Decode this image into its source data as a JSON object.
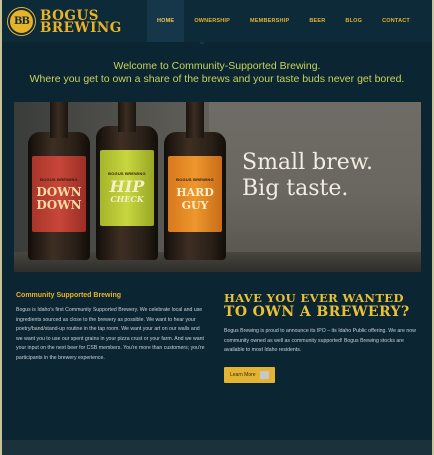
{
  "brand": {
    "badge": "BB",
    "line1": "BOGUS",
    "line2": "BREWING"
  },
  "nav": {
    "items": [
      {
        "label": "HOME",
        "active": true
      },
      {
        "label": "OWNERSHIP",
        "active": false
      },
      {
        "label": "MEMBERSHIP",
        "active": false
      },
      {
        "label": "BEER",
        "active": false
      },
      {
        "label": "BLOG",
        "active": false
      },
      {
        "label": "CONTACT",
        "active": false
      }
    ]
  },
  "welcome": {
    "line1": "Welcome to Community-Supported Brewing.",
    "line2": "Where you get to own a share of the brews and your taste buds never get bored."
  },
  "hero": {
    "headline_line1": "Small brew.",
    "headline_line2": "Big taste.",
    "bottles": [
      {
        "brand": "BOGUS BREWING",
        "name_line1": "DOWN",
        "name_line2": "DOWN"
      },
      {
        "brand": "BOGUS BREWING",
        "name_line1": "HIP",
        "name_line2": "CHECK"
      },
      {
        "brand": "BOGUS BREWING",
        "name_line1": "HARD",
        "name_line2": "GUY"
      }
    ]
  },
  "community": {
    "heading": "Community Supported Brewing",
    "body": "Bogus is Idaho's first Community Supported Brewery. We celebrate local and use ingredients sourced as close to the brewery as possible. We want to hear your poetry/band/stand-up routine in the tap room. We want your art on our walls and we want you to use our spent grains in your pizza crust or your farm. And we want your input on the next beer for CSB members. You're more than customers; you're participants in the brewery experience."
  },
  "ipo": {
    "heading_line1": "HAVE YOU EVER WANTED",
    "heading_line2": "TO OWN A BREWERY?",
    "body": "Bogus Brewing is proud to announce its IPO – its Idaho Public offering. We are now community owned as well as community supported! Bogus Brewing stocks are available to most Idaho residents.",
    "button_label": "Learn More"
  },
  "colors": {
    "background": "#0b2533",
    "accent": "#e9b328",
    "welcome_text": "#c7d35a"
  }
}
